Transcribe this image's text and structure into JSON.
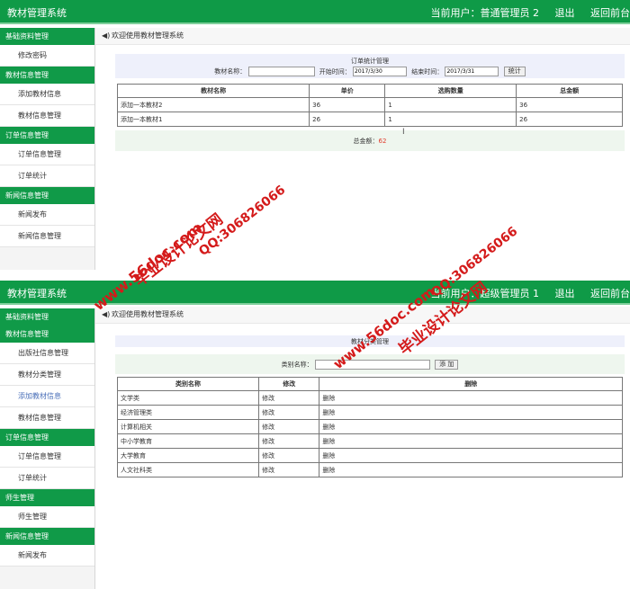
{
  "panel1": {
    "app_title": "教材管理系统",
    "current_user": "当前用户：普通管理员 2",
    "logout": "退出",
    "back_front": "返回前台",
    "welcome": "欢迎使用教材管理系统",
    "sidebar": [
      {
        "type": "head",
        "label": "基础资料管理"
      },
      {
        "type": "item",
        "label": "修改密码"
      },
      {
        "type": "head",
        "label": "教材信息管理"
      },
      {
        "type": "item",
        "label": "添加教材信息"
      },
      {
        "type": "item",
        "label": "教材信息管理"
      },
      {
        "type": "head",
        "label": "订单信息管理"
      },
      {
        "type": "item",
        "label": "订单信息管理"
      },
      {
        "type": "item",
        "label": "订单统计"
      },
      {
        "type": "head",
        "label": "新闻信息管理"
      },
      {
        "type": "item",
        "label": "新闻发布"
      },
      {
        "type": "item",
        "label": "新闻信息管理"
      }
    ],
    "stats_title": "订单统计管理",
    "name_label": "教材名称：",
    "name_value": "",
    "start_label": "开始时间：",
    "start_value": "2017/3/30",
    "end_label": "结束时间：",
    "end_value": "2017/3/31",
    "stats_button": "统计",
    "columns": [
      "教材名称",
      "单价",
      "选购数量",
      "总金额"
    ],
    "rows": [
      [
        "添加一本教材2",
        "36",
        "1",
        "36"
      ],
      [
        "添加一本教材1",
        "26",
        "1",
        "26"
      ]
    ],
    "total_label": "总金额：",
    "total_value": "62"
  },
  "panel2": {
    "app_title": "教材管理系统",
    "current_user": "当前用户：超级管理员 1",
    "logout": "退出",
    "back_front": "返回前台",
    "welcome": "欢迎使用教材管理系统",
    "sidebar": [
      {
        "type": "head",
        "label": "基础资料管理"
      },
      {
        "type": "head",
        "label": "教材信息管理"
      },
      {
        "type": "item",
        "label": "出版社信息管理"
      },
      {
        "type": "item",
        "label": "教材分类管理"
      },
      {
        "type": "item",
        "label": "添加教材信息",
        "link": true
      },
      {
        "type": "item",
        "label": "教材信息管理"
      },
      {
        "type": "head",
        "label": "订单信息管理"
      },
      {
        "type": "item",
        "label": "订单信息管理"
      },
      {
        "type": "item",
        "label": "订单统计"
      },
      {
        "type": "head",
        "label": "师生管理"
      },
      {
        "type": "item",
        "label": "师生管理"
      },
      {
        "type": "head",
        "label": "新闻信息管理"
      },
      {
        "type": "item",
        "label": "新闻发布"
      }
    ],
    "category_title": "教材分类管理",
    "category_label": "类别名称：",
    "category_value": "",
    "add_button": "添 加",
    "columns": [
      "类别名称",
      "修改",
      "删除"
    ],
    "rows": [
      [
        "文学类",
        "修改",
        "删除"
      ],
      [
        "经济管理类",
        "修改",
        "删除"
      ],
      [
        "计算机相关",
        "修改",
        "删除"
      ],
      [
        "中小学教育",
        "修改",
        "删除"
      ],
      [
        "大学教育",
        "修改",
        "删除"
      ],
      [
        "人文社科类",
        "修改",
        "删除"
      ]
    ]
  },
  "watermark": {
    "site": "www.56doc.com",
    "name": "毕业设计论文网",
    "qq": "QQ:306826066"
  },
  "colors": {
    "header_green": "#0f9a47",
    "total_red": "#e03a2a",
    "watermark_red": "#d41a1a",
    "link_blue": "#4a6fb8"
  }
}
